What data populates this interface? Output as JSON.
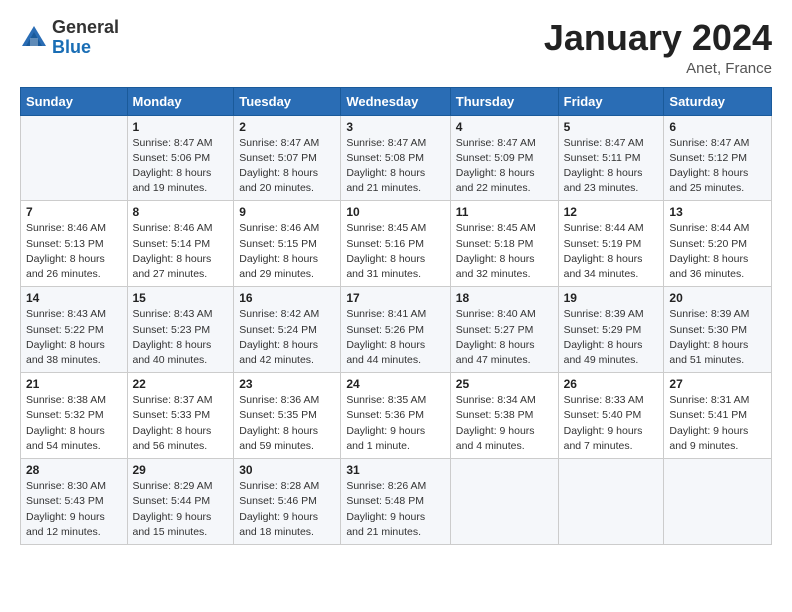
{
  "header": {
    "logo_general": "General",
    "logo_blue": "Blue",
    "month_title": "January 2024",
    "location": "Anet, France"
  },
  "weekdays": [
    "Sunday",
    "Monday",
    "Tuesday",
    "Wednesday",
    "Thursday",
    "Friday",
    "Saturday"
  ],
  "weeks": [
    [
      {
        "day": "",
        "sunrise": "",
        "sunset": "",
        "daylight": ""
      },
      {
        "day": "1",
        "sunrise": "Sunrise: 8:47 AM",
        "sunset": "Sunset: 5:06 PM",
        "daylight": "Daylight: 8 hours and 19 minutes."
      },
      {
        "day": "2",
        "sunrise": "Sunrise: 8:47 AM",
        "sunset": "Sunset: 5:07 PM",
        "daylight": "Daylight: 8 hours and 20 minutes."
      },
      {
        "day": "3",
        "sunrise": "Sunrise: 8:47 AM",
        "sunset": "Sunset: 5:08 PM",
        "daylight": "Daylight: 8 hours and 21 minutes."
      },
      {
        "day": "4",
        "sunrise": "Sunrise: 8:47 AM",
        "sunset": "Sunset: 5:09 PM",
        "daylight": "Daylight: 8 hours and 22 minutes."
      },
      {
        "day": "5",
        "sunrise": "Sunrise: 8:47 AM",
        "sunset": "Sunset: 5:11 PM",
        "daylight": "Daylight: 8 hours and 23 minutes."
      },
      {
        "day": "6",
        "sunrise": "Sunrise: 8:47 AM",
        "sunset": "Sunset: 5:12 PM",
        "daylight": "Daylight: 8 hours and 25 minutes."
      }
    ],
    [
      {
        "day": "7",
        "sunrise": "Sunrise: 8:46 AM",
        "sunset": "Sunset: 5:13 PM",
        "daylight": "Daylight: 8 hours and 26 minutes."
      },
      {
        "day": "8",
        "sunrise": "Sunrise: 8:46 AM",
        "sunset": "Sunset: 5:14 PM",
        "daylight": "Daylight: 8 hours and 27 minutes."
      },
      {
        "day": "9",
        "sunrise": "Sunrise: 8:46 AM",
        "sunset": "Sunset: 5:15 PM",
        "daylight": "Daylight: 8 hours and 29 minutes."
      },
      {
        "day": "10",
        "sunrise": "Sunrise: 8:45 AM",
        "sunset": "Sunset: 5:16 PM",
        "daylight": "Daylight: 8 hours and 31 minutes."
      },
      {
        "day": "11",
        "sunrise": "Sunrise: 8:45 AM",
        "sunset": "Sunset: 5:18 PM",
        "daylight": "Daylight: 8 hours and 32 minutes."
      },
      {
        "day": "12",
        "sunrise": "Sunrise: 8:44 AM",
        "sunset": "Sunset: 5:19 PM",
        "daylight": "Daylight: 8 hours and 34 minutes."
      },
      {
        "day": "13",
        "sunrise": "Sunrise: 8:44 AM",
        "sunset": "Sunset: 5:20 PM",
        "daylight": "Daylight: 8 hours and 36 minutes."
      }
    ],
    [
      {
        "day": "14",
        "sunrise": "Sunrise: 8:43 AM",
        "sunset": "Sunset: 5:22 PM",
        "daylight": "Daylight: 8 hours and 38 minutes."
      },
      {
        "day": "15",
        "sunrise": "Sunrise: 8:43 AM",
        "sunset": "Sunset: 5:23 PM",
        "daylight": "Daylight: 8 hours and 40 minutes."
      },
      {
        "day": "16",
        "sunrise": "Sunrise: 8:42 AM",
        "sunset": "Sunset: 5:24 PM",
        "daylight": "Daylight: 8 hours and 42 minutes."
      },
      {
        "day": "17",
        "sunrise": "Sunrise: 8:41 AM",
        "sunset": "Sunset: 5:26 PM",
        "daylight": "Daylight: 8 hours and 44 minutes."
      },
      {
        "day": "18",
        "sunrise": "Sunrise: 8:40 AM",
        "sunset": "Sunset: 5:27 PM",
        "daylight": "Daylight: 8 hours and 47 minutes."
      },
      {
        "day": "19",
        "sunrise": "Sunrise: 8:39 AM",
        "sunset": "Sunset: 5:29 PM",
        "daylight": "Daylight: 8 hours and 49 minutes."
      },
      {
        "day": "20",
        "sunrise": "Sunrise: 8:39 AM",
        "sunset": "Sunset: 5:30 PM",
        "daylight": "Daylight: 8 hours and 51 minutes."
      }
    ],
    [
      {
        "day": "21",
        "sunrise": "Sunrise: 8:38 AM",
        "sunset": "Sunset: 5:32 PM",
        "daylight": "Daylight: 8 hours and 54 minutes."
      },
      {
        "day": "22",
        "sunrise": "Sunrise: 8:37 AM",
        "sunset": "Sunset: 5:33 PM",
        "daylight": "Daylight: 8 hours and 56 minutes."
      },
      {
        "day": "23",
        "sunrise": "Sunrise: 8:36 AM",
        "sunset": "Sunset: 5:35 PM",
        "daylight": "Daylight: 8 hours and 59 minutes."
      },
      {
        "day": "24",
        "sunrise": "Sunrise: 8:35 AM",
        "sunset": "Sunset: 5:36 PM",
        "daylight": "Daylight: 9 hours and 1 minute."
      },
      {
        "day": "25",
        "sunrise": "Sunrise: 8:34 AM",
        "sunset": "Sunset: 5:38 PM",
        "daylight": "Daylight: 9 hours and 4 minutes."
      },
      {
        "day": "26",
        "sunrise": "Sunrise: 8:33 AM",
        "sunset": "Sunset: 5:40 PM",
        "daylight": "Daylight: 9 hours and 7 minutes."
      },
      {
        "day": "27",
        "sunrise": "Sunrise: 8:31 AM",
        "sunset": "Sunset: 5:41 PM",
        "daylight": "Daylight: 9 hours and 9 minutes."
      }
    ],
    [
      {
        "day": "28",
        "sunrise": "Sunrise: 8:30 AM",
        "sunset": "Sunset: 5:43 PM",
        "daylight": "Daylight: 9 hours and 12 minutes."
      },
      {
        "day": "29",
        "sunrise": "Sunrise: 8:29 AM",
        "sunset": "Sunset: 5:44 PM",
        "daylight": "Daylight: 9 hours and 15 minutes."
      },
      {
        "day": "30",
        "sunrise": "Sunrise: 8:28 AM",
        "sunset": "Sunset: 5:46 PM",
        "daylight": "Daylight: 9 hours and 18 minutes."
      },
      {
        "day": "31",
        "sunrise": "Sunrise: 8:26 AM",
        "sunset": "Sunset: 5:48 PM",
        "daylight": "Daylight: 9 hours and 21 minutes."
      },
      {
        "day": "",
        "sunrise": "",
        "sunset": "",
        "daylight": ""
      },
      {
        "day": "",
        "sunrise": "",
        "sunset": "",
        "daylight": ""
      },
      {
        "day": "",
        "sunrise": "",
        "sunset": "",
        "daylight": ""
      }
    ]
  ]
}
